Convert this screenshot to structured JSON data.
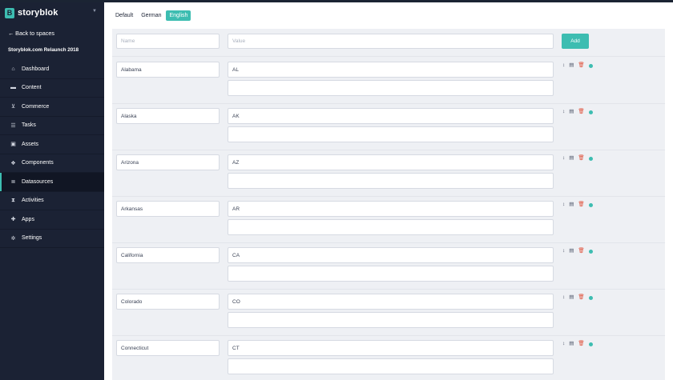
{
  "sidebar": {
    "brand": "storyblok",
    "brand_logo": "B",
    "back_link": "← Back to spaces",
    "space_name": "Storyblok.com Relaunch 2018",
    "items": [
      {
        "label": "Dashboard",
        "icon": "home-icon",
        "glyph": "⌂"
      },
      {
        "label": "Content",
        "icon": "folder-icon",
        "glyph": "▬"
      },
      {
        "label": "Commerce",
        "icon": "cart-icon",
        "glyph": "⊻"
      },
      {
        "label": "Tasks",
        "icon": "tasks-icon",
        "glyph": "☰"
      },
      {
        "label": "Assets",
        "icon": "image-icon",
        "glyph": "▣"
      },
      {
        "label": "Components",
        "icon": "components-icon",
        "glyph": "❖"
      },
      {
        "label": "Datasources",
        "icon": "database-icon",
        "glyph": "≣"
      },
      {
        "label": "Activities",
        "icon": "hourglass-icon",
        "glyph": "⧗"
      },
      {
        "label": "Apps",
        "icon": "puzzle-icon",
        "glyph": "✚"
      },
      {
        "label": "Settings",
        "icon": "gear-icon",
        "glyph": "✲"
      }
    ],
    "active_index": 6
  },
  "tabs": [
    "Default",
    "German",
    "English"
  ],
  "active_tab": 2,
  "header": {
    "name_placeholder": "Name",
    "value_placeholder": "Value",
    "add_label": "Add"
  },
  "rows": [
    {
      "name": "Alabama",
      "value": "AL",
      "dimension": ""
    },
    {
      "name": "Alaska",
      "value": "AK",
      "dimension": ""
    },
    {
      "name": "Arizona",
      "value": "AZ",
      "dimension": ""
    },
    {
      "name": "Arkansas",
      "value": "AR",
      "dimension": ""
    },
    {
      "name": "California",
      "value": "CA",
      "dimension": ""
    },
    {
      "name": "Colorado",
      "value": "CO",
      "dimension": ""
    },
    {
      "name": "Connecticut",
      "value": "CT",
      "dimension": ""
    }
  ],
  "row_actions": {
    "move": "↕",
    "save": "▤",
    "delete": "🗑",
    "status_color": "#3dbdb1"
  },
  "colors": {
    "accent": "#3dbdb1",
    "sidebar_bg": "#1b2234",
    "delete": "#e0523c"
  }
}
